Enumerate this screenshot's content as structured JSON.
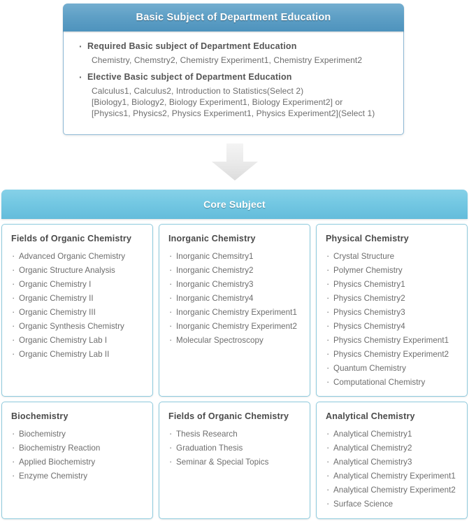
{
  "basic": {
    "header_title": "Basic Subject of Department Education",
    "groups": [
      {
        "title": "Required Basic subject of Department Education",
        "lines": [
          "Chemistry, Chemstry2, Chemistry Experiment1, Chemistry Experiment2"
        ]
      },
      {
        "title": "Elective Basic subject of Department Education",
        "lines": [
          "Calculus1, Calculus2, Introduction to Statistics(Select 2)",
          "[Biology1, Biology2, Biology Experiment1, Biology Experiment2] or",
          "[Physics1, Physics2, Physics Experiment1, Physics Experiment2](Select 1)"
        ]
      }
    ]
  },
  "arrow": {
    "icon": "arrow-down-icon"
  },
  "core": {
    "header_title": "Core Subject",
    "cards": [
      {
        "title": "Fields of Organic Chemistry",
        "items": [
          "Advanced Organic Chemistry",
          "Organic Structure Analysis",
          "Organic Chemistry I",
          "Organic Chemistry II",
          "Organic Chemistry III",
          "Organic Synthesis Chemistry",
          "Organic Chemistry Lab I",
          "Organic Chemistry Lab II"
        ]
      },
      {
        "title": "Inorganic Chemistry",
        "items": [
          "Inorganic Chemsitry1",
          "Inorganic Chemistry2",
          "Inorganic Chemistry3",
          "Inorganic Chemistry4",
          "Inorganic Chemistry Experiment1",
          "Inorganic Chemistry Experiment2",
          "Molecular Spectroscopy"
        ]
      },
      {
        "title": "Physical Chemistry",
        "items": [
          "Crystal Structure",
          "Polymer Chemistry",
          "Physics Chemistry1",
          "Physics Chemistry2",
          "Physics Chemistry3",
          "Physics Chemistry4",
          "Physics Chemistry Experiment1",
          "Physics Chemistry Experiment2",
          "Quantum Chemistry",
          "Computational Chemistry"
        ]
      },
      {
        "title": "Biochemistry",
        "items": [
          "Biochemistry",
          "Biochemistry Reaction",
          "Applied Biochemistry",
          "Enzyme Chemistry"
        ]
      },
      {
        "title": "Fields of Organic Chemistry",
        "items": [
          "Thesis Research",
          "Graduation Thesis",
          "Seminar & Special Topics"
        ]
      },
      {
        "title": "Analytical Chemistry",
        "items": [
          "Analytical Chemistry1",
          "Analytical Chemistry2",
          "Analytical Chemistry3",
          "Analytical Chemistry Experiment1",
          "Analytical Chemistry Experiment2",
          "Surface Science"
        ]
      }
    ]
  },
  "colors": {
    "basic_header_blue": "#5fa0c6",
    "core_header_blue": "#72c7e2",
    "card_border": "#8ecadd",
    "text_gray": "#6d6d6d",
    "arrow_gray": "#e8e8e8"
  }
}
